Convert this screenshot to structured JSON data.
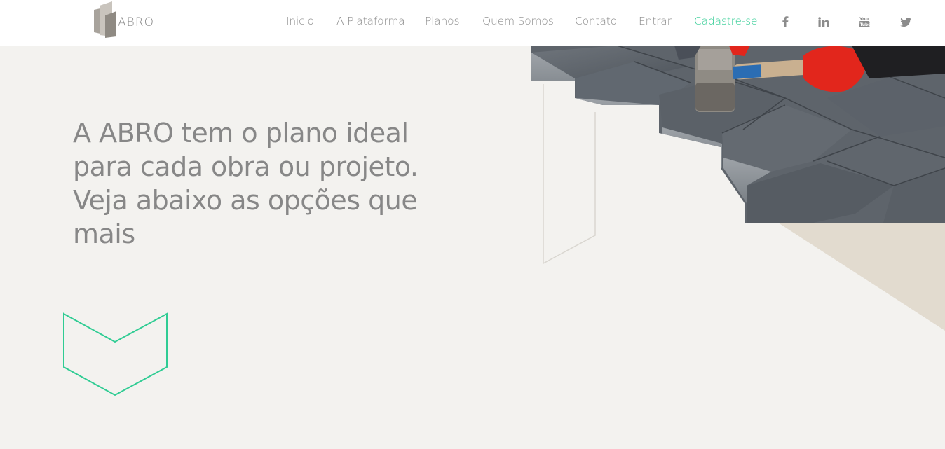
{
  "brand": {
    "logo_text": "ABRO"
  },
  "nav": {
    "items": [
      {
        "label": "Inicio"
      },
      {
        "label": "A Plataforma"
      },
      {
        "label": "Planos"
      },
      {
        "label": "Quem Somos"
      },
      {
        "label": "Contato"
      },
      {
        "label": "Entrar"
      },
      {
        "label": "Cadastre-se"
      }
    ],
    "social": [
      {
        "icon": "facebook-icon"
      },
      {
        "icon": "linkedin-icon"
      },
      {
        "icon": "youtube-icon"
      },
      {
        "icon": "twitter-icon"
      }
    ]
  },
  "hero": {
    "title": "A ABRO tem o plano ideal para cada obra ou projeto. Veja abaixo as opções que mais"
  },
  "colors": {
    "accent": "#2fcc93",
    "background": "#f3f2ef",
    "text": "#878787",
    "beige": "#e2dbcf"
  }
}
